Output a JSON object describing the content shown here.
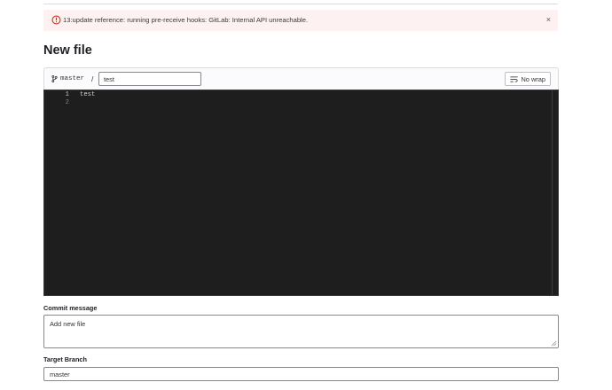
{
  "alert": {
    "icon": "error-circle-icon",
    "message": "13:update reference: running pre-receive hooks: GitLab: Internal API unreachable.",
    "close_glyph": "×",
    "color": "#dd2b0e"
  },
  "page": {
    "title": "New file"
  },
  "file_header": {
    "branch_icon": "branch-icon",
    "branch": "master",
    "separator": "/",
    "filename": "test",
    "no_wrap_label": "No wrap",
    "no_wrap_icon": "wrap-icon"
  },
  "editor": {
    "lines": [
      {
        "number": "1",
        "text": "test"
      },
      {
        "number": "2",
        "text": ""
      }
    ]
  },
  "commit": {
    "label": "Commit message",
    "value": "Add new file"
  },
  "target_branch": {
    "label": "Target Branch",
    "value": "master"
  }
}
